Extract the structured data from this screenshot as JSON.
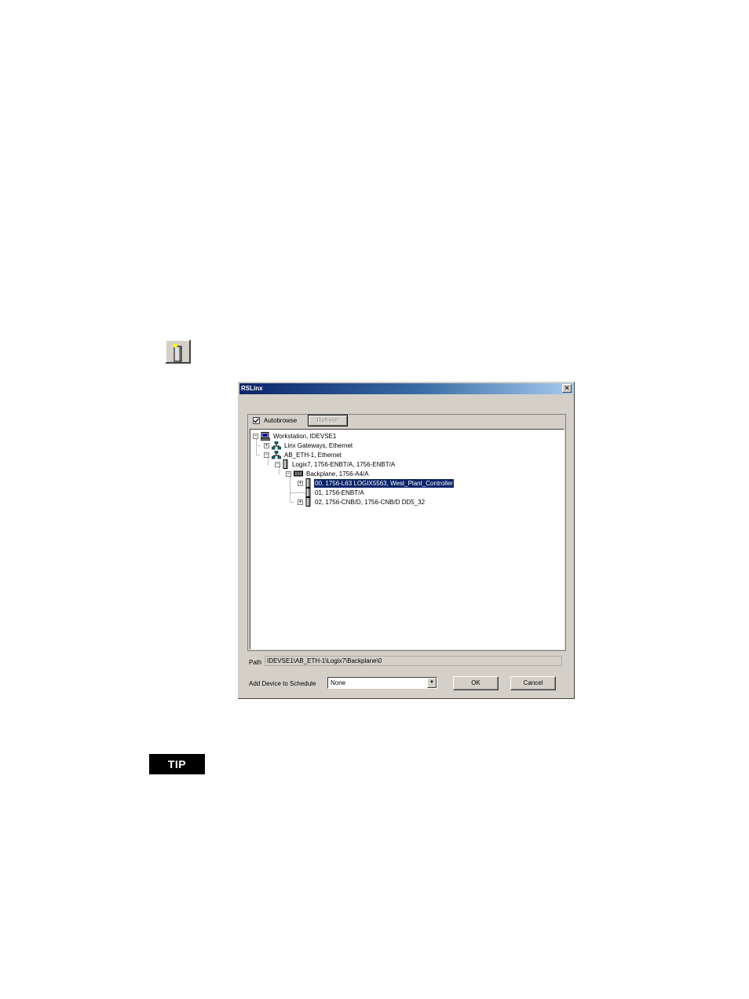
{
  "dialog": {
    "title": "RSLinx",
    "close_glyph": "✕",
    "autobrowse_label": "Autobrowse",
    "autobrowse_checked": true,
    "refresh_label": "Refresh",
    "tree": [
      {
        "label": "Workstation, IDEVSE1",
        "icon": "workstation-icon",
        "expander": "−"
      },
      {
        "label": "Linx Gateways, Ethernet",
        "icon": "network-icon",
        "expander": "+"
      },
      {
        "label": "AB_ETH-1, Ethernet",
        "icon": "network-icon",
        "expander": "−"
      },
      {
        "label": "Logix7, 1756-ENBT/A, 1756-ENBT/A",
        "icon": "module-icon",
        "expander": "−"
      },
      {
        "label": "Backplane, 1756-A4/A",
        "icon": "backplane-icon",
        "expander": "−"
      },
      {
        "label": "00, 1756-L63 LOGIX5563, West_Plant_Controller",
        "icon": "module-icon",
        "expander": "+",
        "selected": true
      },
      {
        "label": "01, 1756-ENBT/A",
        "icon": "module-icon",
        "expander": ""
      },
      {
        "label": "02, 1756-CNB/D, 1756-CNB/D DD5_32",
        "icon": "module-icon",
        "expander": "+"
      }
    ],
    "path_label": "Path",
    "path_value": "IDEVSE1\\AB_ETH-1\\Logix7\\Backplane\\0",
    "schedule_label": "Add Device to Schedule",
    "schedule_value": "None",
    "schedule_arrow": "▼",
    "ok_label": "OK",
    "cancel_label": "Cancel"
  },
  "tip_label": "TIP"
}
